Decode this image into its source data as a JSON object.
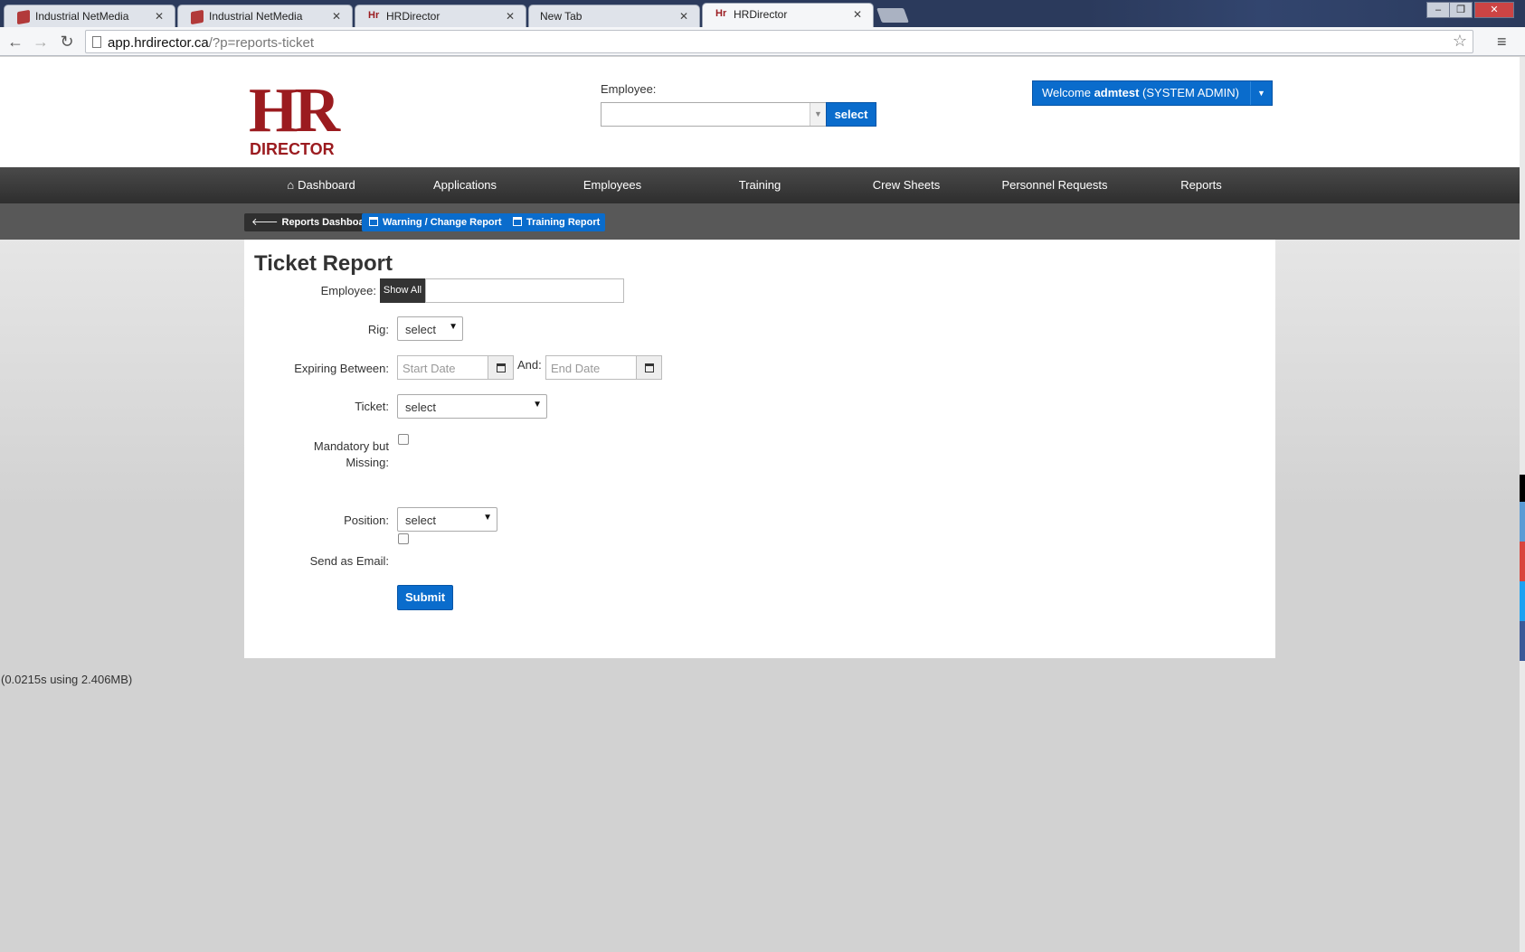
{
  "browser": {
    "tabs": [
      {
        "title": "Industrial NetMedia",
        "active": false
      },
      {
        "title": "Industrial NetMedia",
        "active": false
      },
      {
        "title": "HRDirector",
        "active": false
      },
      {
        "title": "New Tab",
        "active": false
      },
      {
        "title": "HRDirector",
        "active": true
      }
    ],
    "url_host": "app.hrdirector.ca",
    "url_path": "/?p=reports-ticket"
  },
  "header": {
    "logo_letters": "HR",
    "logo_word": "DIRECTOR",
    "employee_label": "Employee:",
    "employee_select_value": "",
    "select_button": "select",
    "welcome_prefix": "Welcome ",
    "welcome_user": "admtest",
    "welcome_role": " (SYSTEM ADMIN)"
  },
  "main_nav": [
    "Dashboard",
    "Applications",
    "Employees",
    "Training",
    "Crew Sheets",
    "Personnel Requests",
    "Reports"
  ],
  "sub_nav": {
    "back": "Reports Dashboard",
    "warning": "Warning / Change Report",
    "training": "Training Report"
  },
  "form": {
    "title": "Ticket Report",
    "employee_label": "Employee:",
    "show_all": "Show All",
    "employee_value": "",
    "rig_label": "Rig:",
    "rig_value": "select",
    "expiring_label": "Expiring Between:",
    "start_placeholder": "Start Date",
    "and_label": "And:",
    "end_placeholder": "End Date",
    "ticket_label": "Ticket:",
    "ticket_value": "select",
    "mandatory_label_1": "Mandatory but",
    "mandatory_label_2": "Missing:",
    "mandatory_checked": false,
    "position_label": "Position:",
    "position_value": "select",
    "email_label": "Send as Email:",
    "email_checked": false,
    "submit": "Submit"
  },
  "footer": {
    "stats": "(0.0215s using 2.406MB)"
  },
  "colors": {
    "brand": "#9b1b1f",
    "primary": "#0a6ccc",
    "nav_bg": "#2e2e2e",
    "subnav_bg": "#585858"
  }
}
